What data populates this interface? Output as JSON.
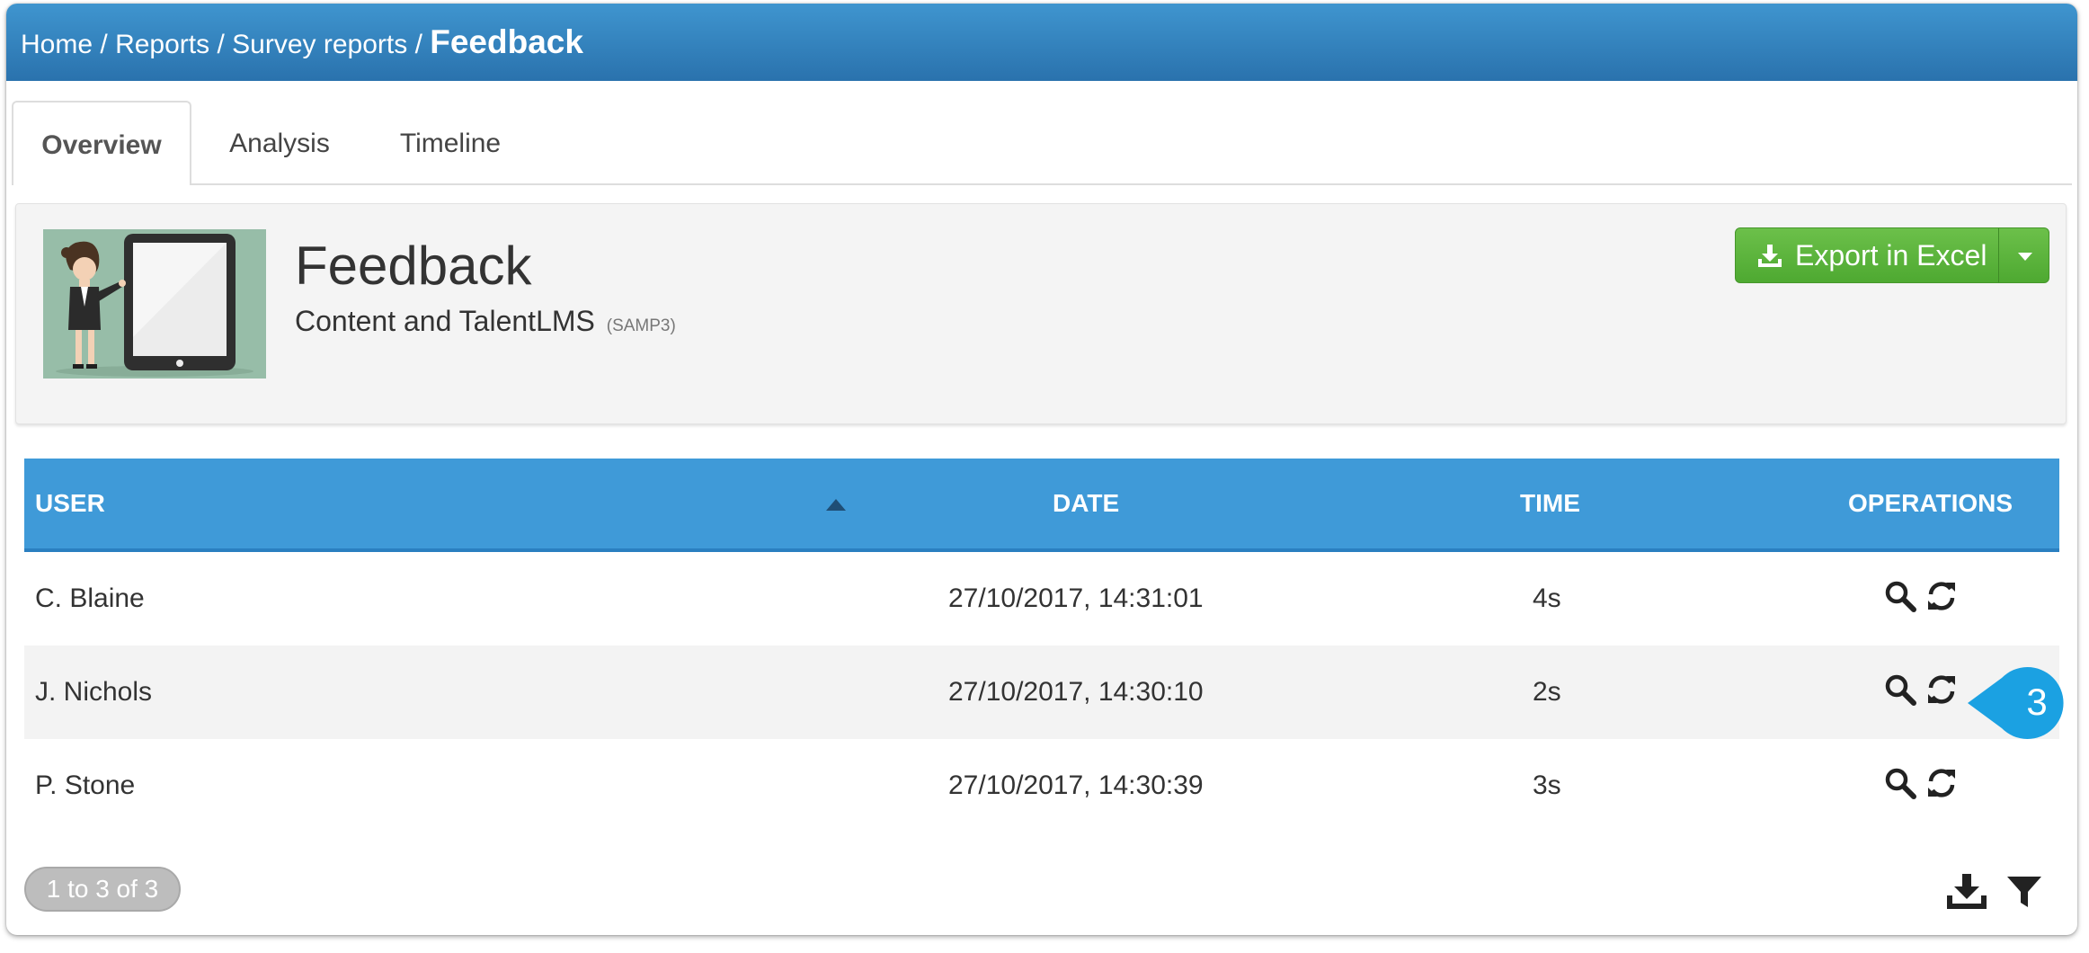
{
  "breadcrumb": {
    "home": "Home",
    "sep": "/",
    "reports": "Reports",
    "survey_reports": "Survey reports",
    "current": "Feedback"
  },
  "tabs": [
    "Overview",
    "Analysis",
    "Timeline"
  ],
  "summary": {
    "title": "Feedback",
    "subtitle": "Content and TalentLMS",
    "code": "(SAMP3)",
    "export_label": "Export in Excel"
  },
  "table": {
    "headers": {
      "user": "USER",
      "date": "DATE",
      "time": "TIME",
      "operations": "OPERATIONS"
    },
    "rows": [
      {
        "user": "C. Blaine",
        "date": "27/10/2017, 14:31:01",
        "time": "4s"
      },
      {
        "user": "J. Nichols",
        "date": "27/10/2017, 14:30:10",
        "time": "2s"
      },
      {
        "user": "P. Stone",
        "date": "27/10/2017, 14:30:39",
        "time": "3s"
      }
    ]
  },
  "pagination": {
    "label": "1 to 3 of 3"
  },
  "callout": {
    "number": "3"
  },
  "colors": {
    "header_blue": "#2a72ad",
    "table_header": "#3f9ad8",
    "export_green": "#5cb63c",
    "callout": "#1ba1e2"
  },
  "icons": [
    "search-icon",
    "reset-icon",
    "download-icon",
    "filter-icon",
    "caret-down-icon",
    "sort-asc-icon"
  ]
}
